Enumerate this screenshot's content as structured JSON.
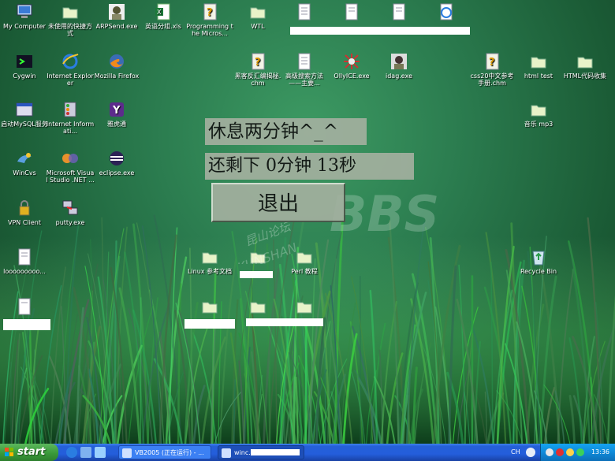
{
  "desktop_icons": [
    {
      "label": "My Computer",
      "icon": "computer-icon"
    },
    {
      "label": "未使用的快捷方式",
      "icon": "folder-icon"
    },
    {
      "label": "ARPSend.exe",
      "icon": "portrait-icon"
    },
    {
      "label": "英语分组.xls",
      "icon": "excel-icon"
    },
    {
      "label": "Programming the Micros...",
      "icon": "help-file-icon"
    },
    {
      "label": "WTL",
      "icon": "folder-icon"
    },
    {
      "label": "Cygwin",
      "icon": "cygwin-icon"
    },
    {
      "label": "Internet Explorer",
      "icon": "ie-icon"
    },
    {
      "label": "Mozilla Firefox",
      "icon": "firefox-icon"
    },
    {
      "label": "黑客反汇编揭秘.chm",
      "icon": "help-file-icon"
    },
    {
      "label": "高级搜索方法——主要...",
      "icon": "document-icon"
    },
    {
      "label": "OllyICE.exe",
      "icon": "bug-icon"
    },
    {
      "label": "idag.exe",
      "icon": "portrait-icon"
    },
    {
      "label": "css20中文参考手册.chm",
      "icon": "help-file-icon"
    },
    {
      "label": "html test",
      "icon": "folder-icon"
    },
    {
      "label": "HTML代码收集",
      "icon": "folder-icon"
    },
    {
      "label": "启动MySQL服务",
      "icon": "window-icon"
    },
    {
      "label": "Internet Informati...",
      "icon": "iis-icon"
    },
    {
      "label": "雅虎通",
      "icon": "yahoo-icon"
    },
    {
      "label": "音乐 mp3",
      "icon": "folder-icon"
    },
    {
      "label": "WinCvs",
      "icon": "wincvs-icon"
    },
    {
      "label": "Microsoft Visual Studio .NET ...",
      "icon": "visual-studio-icon"
    },
    {
      "label": "eclipse.exe",
      "icon": "eclipse-icon"
    },
    {
      "label": "VPN Client",
      "icon": "vpn-icon"
    },
    {
      "label": "putty.exe",
      "icon": "putty-icon"
    },
    {
      "label": "looooooooo...",
      "icon": "document-icon"
    },
    {
      "label": "Linux 参考文档",
      "icon": "folder-icon"
    },
    {
      "label": "",
      "icon": "folder-icon"
    },
    {
      "label": "Perl 教程",
      "icon": "folder-icon"
    },
    {
      "label": "Recycle Bin",
      "icon": "recycle-bin-icon"
    },
    {
      "label": "",
      "icon": "document-icon"
    },
    {
      "label": "",
      "icon": "folder-icon"
    },
    {
      "label": "",
      "icon": "folder-icon"
    },
    {
      "label": "",
      "icon": "folder-icon"
    },
    {
      "label": "",
      "icon": "document-icon"
    },
    {
      "label": "",
      "icon": "document-icon"
    },
    {
      "label": "",
      "icon": "document-icon"
    },
    {
      "label": "",
      "icon": "ie-icon"
    }
  ],
  "overlay": {
    "line1": "休息两分钟^_^",
    "line2": "还剩下 0分钟 13秒",
    "exit_button": "退出"
  },
  "watermark": {
    "text": "BBS",
    "sub": "昆山论坛",
    "sub2": "KUNSHAN"
  },
  "taskbar": {
    "start_label": "start",
    "tasks": [
      {
        "label": "VB2005 (正在运行) - ..."
      },
      {
        "label": "winc..."
      }
    ],
    "language": "CH",
    "clock": "13:36"
  },
  "colors": {
    "taskbar_blue": "#245edb",
    "start_green": "#3a9a3a",
    "panel_gray": "#a3b09f"
  }
}
